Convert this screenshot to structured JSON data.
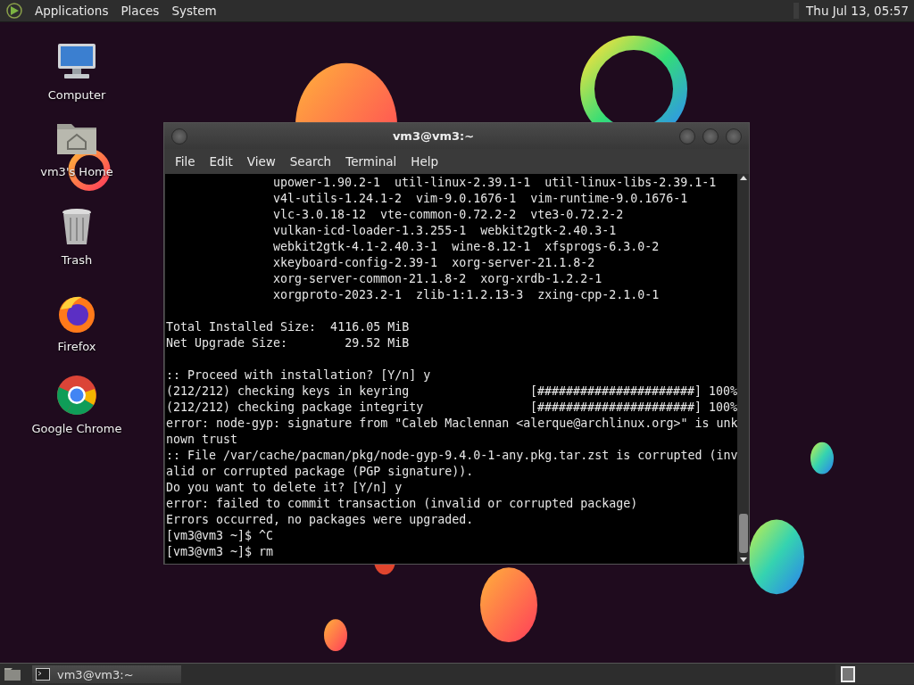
{
  "top_panel": {
    "menus": [
      {
        "label": "Applications"
      },
      {
        "label": "Places"
      },
      {
        "label": "System"
      }
    ],
    "clock": "Thu Jul 13, 05:57"
  },
  "desktop_icons": [
    {
      "kind": "computer",
      "label": "Computer"
    },
    {
      "kind": "home",
      "label": "vm3's Home"
    },
    {
      "kind": "trash",
      "label": "Trash"
    },
    {
      "kind": "firefox",
      "label": "Firefox"
    },
    {
      "kind": "chrome",
      "label": "Google Chrome"
    }
  ],
  "terminal": {
    "title": "vm3@vm3:~",
    "menu": [
      {
        "label": "File"
      },
      {
        "label": "Edit"
      },
      {
        "label": "View"
      },
      {
        "label": "Search"
      },
      {
        "label": "Terminal"
      },
      {
        "label": "Help"
      }
    ],
    "lines": [
      {
        "kind": "package",
        "text": "upower-1.90.2-1  util-linux-2.39.1-1  util-linux-libs-2.39.1-1"
      },
      {
        "kind": "package",
        "text": "v4l-utils-1.24.1-2  vim-9.0.1676-1  vim-runtime-9.0.1676-1"
      },
      {
        "kind": "package",
        "text": "vlc-3.0.18-12  vte-common-0.72.2-2  vte3-0.72.2-2"
      },
      {
        "kind": "package",
        "text": "vulkan-icd-loader-1.3.255-1  webkit2gtk-2.40.3-1"
      },
      {
        "kind": "package",
        "text": "webkit2gtk-4.1-2.40.3-1  wine-8.12-1  xfsprogs-6.3.0-2"
      },
      {
        "kind": "package",
        "text": "xkeyboard-config-2.39-1  xorg-server-21.1.8-2"
      },
      {
        "kind": "package",
        "text": "xorg-server-common-21.1.8-2  xorg-xrdb-1.2.2-1"
      },
      {
        "kind": "package",
        "text": "xorgproto-2023.2-1  zlib-1:1.2.13-3  zxing-cpp-2.1.0-1"
      },
      {
        "kind": "blank"
      },
      {
        "kind": "plain",
        "text": "Total Installed Size:  4116.05 MiB"
      },
      {
        "kind": "plain",
        "text": "Net Upgrade Size:        29.52 MiB"
      },
      {
        "kind": "blank"
      },
      {
        "kind": "plain",
        "text": ":: Proceed with installation? [Y/n] y"
      },
      {
        "kind": "progress",
        "text": "(212/212) checking keys in keyring",
        "bar": "[######################]",
        "percent": "100%"
      },
      {
        "kind": "progress",
        "text": "(212/212) checking package integrity",
        "bar": "[######################]",
        "percent": "100%"
      },
      {
        "kind": "plain",
        "text": "error: node-gyp: signature from \"Caleb Maclennan <alerque@archlinux.org>\" is unk"
      },
      {
        "kind": "plain",
        "text": "nown trust"
      },
      {
        "kind": "plain",
        "text": ":: File /var/cache/pacman/pkg/node-gyp-9.4.0-1-any.pkg.tar.zst is corrupted (inv"
      },
      {
        "kind": "plain",
        "text": "alid or corrupted package (PGP signature))."
      },
      {
        "kind": "plain",
        "text": "Do you want to delete it? [Y/n] y"
      },
      {
        "kind": "plain",
        "text": "error: failed to commit transaction (invalid or corrupted package)"
      },
      {
        "kind": "plain",
        "text": "Errors occurred, no packages were upgraded."
      },
      {
        "kind": "plain",
        "text": "[vm3@vm3 ~]$ ^C"
      },
      {
        "kind": "plain",
        "text": "[vm3@vm3 ~]$ rm"
      }
    ]
  },
  "taskbar": {
    "tasks": [
      {
        "label": "vm3@vm3:~",
        "selected": true
      }
    ]
  }
}
